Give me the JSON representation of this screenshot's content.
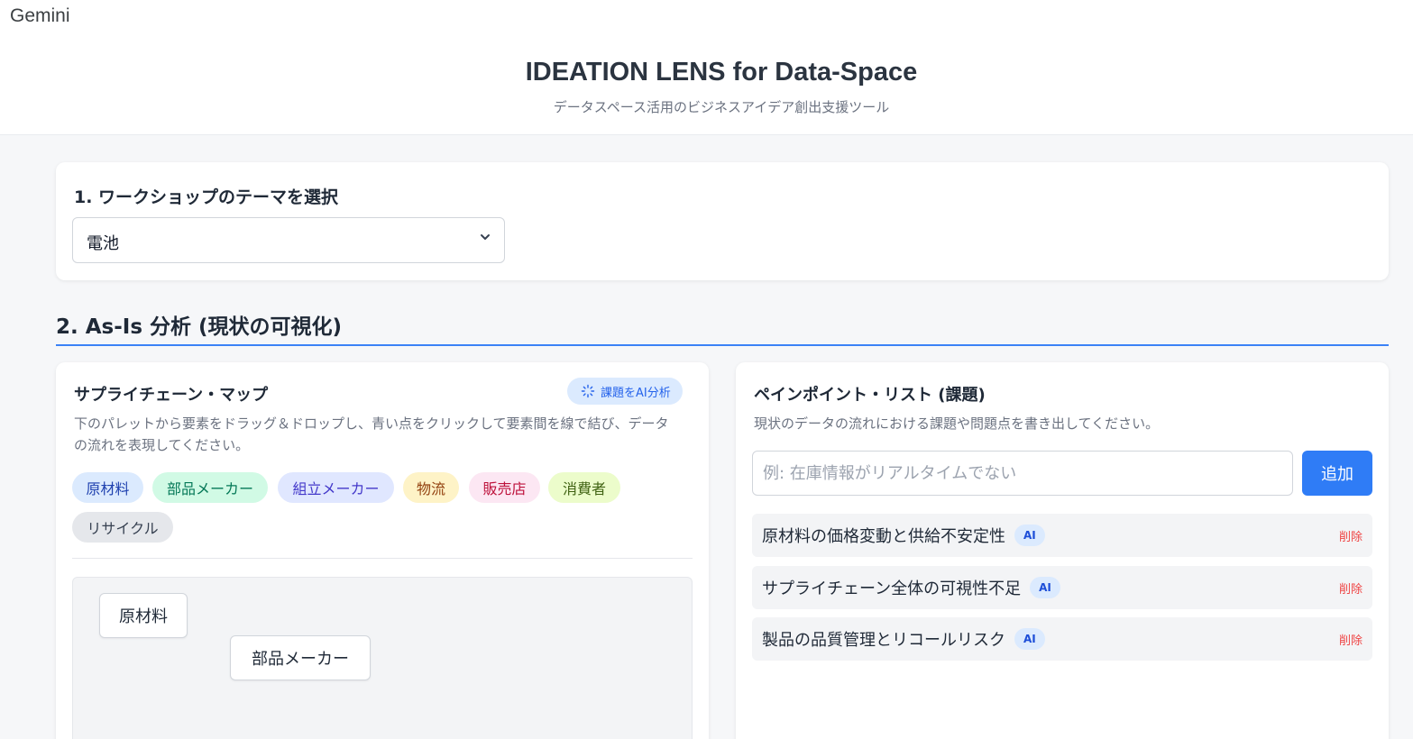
{
  "app": {
    "brand": "Gemini"
  },
  "header": {
    "title": "IDEATION LENS for Data-Space",
    "subtitle": "データスペース活用のビジネスアイデア創出支援ツール"
  },
  "theme": {
    "title": "1. ワークショップのテーマを選択",
    "selected": "電池"
  },
  "asis": {
    "title": "2. As-Is 分析 (現状の可視化)"
  },
  "map": {
    "title": "サプライチェーン・マップ",
    "ai_button": "課題をAI分析",
    "description": "下のパレットから要素をドラッグ＆ドロップし、青い点をクリックして要素間を線で結び、データの流れを表現してください。",
    "palette": [
      {
        "label": "原材料",
        "bg": "#dbeafe",
        "fg": "#1e40af"
      },
      {
        "label": "部品メーカー",
        "bg": "#d1fae5",
        "fg": "#047857"
      },
      {
        "label": "組立メーカー",
        "bg": "#e0e7ff",
        "fg": "#4338ca"
      },
      {
        "label": "物流",
        "bg": "#fef3c7",
        "fg": "#92400e"
      },
      {
        "label": "販売店",
        "bg": "#fce7f3",
        "fg": "#be123c"
      },
      {
        "label": "消費者",
        "bg": "#ecfccb",
        "fg": "#3f6212"
      },
      {
        "label": "リサイクル",
        "bg": "#e5e7eb",
        "fg": "#374151"
      }
    ],
    "nodes": [
      {
        "label": "原材料"
      },
      {
        "label": "部品メーカー"
      }
    ]
  },
  "pain": {
    "title": "ペインポイント・リスト (課題)",
    "description": "現状のデータの流れにおける課題や問題点を書き出してください。",
    "input_placeholder": "例: 在庫情報がリアルタイムでない",
    "add_label": "追加",
    "items": [
      {
        "text": "原材料の価格変動と供給不安定性",
        "badge": "AI",
        "delete": "削除"
      },
      {
        "text": "サプライチェーン全体の可視性不足",
        "badge": "AI",
        "delete": "削除"
      },
      {
        "text": "製品の品質管理とリコールリスク",
        "badge": "AI",
        "delete": "削除"
      }
    ]
  }
}
